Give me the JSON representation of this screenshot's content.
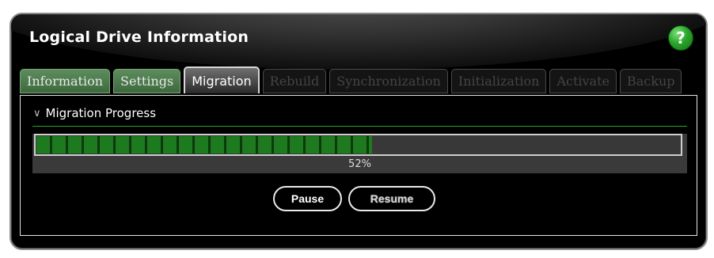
{
  "window": {
    "title": "Logical Drive Information",
    "help_symbol": "?"
  },
  "tabs": [
    {
      "label": "Information",
      "state": "enabled"
    },
    {
      "label": "Settings",
      "state": "enabled"
    },
    {
      "label": "Migration",
      "state": "active"
    },
    {
      "label": "Rebuild",
      "state": "disabled"
    },
    {
      "label": "Synchronization",
      "state": "disabled"
    },
    {
      "label": "Initialization",
      "state": "disabled"
    },
    {
      "label": "Activate",
      "state": "disabled"
    },
    {
      "label": "Backup",
      "state": "disabled"
    }
  ],
  "migration": {
    "section_title": "Migration Progress",
    "progress_value": 0.52,
    "progress_label": "52%",
    "pause_label": "Pause",
    "resume_label": "Resume"
  },
  "icons": {
    "help": "help-icon",
    "section_collapse": "chevron-double-down-icon"
  },
  "colors": {
    "accent_green": "#2aa52a",
    "progress_green": "#1e7a1e",
    "background": "#000000"
  }
}
